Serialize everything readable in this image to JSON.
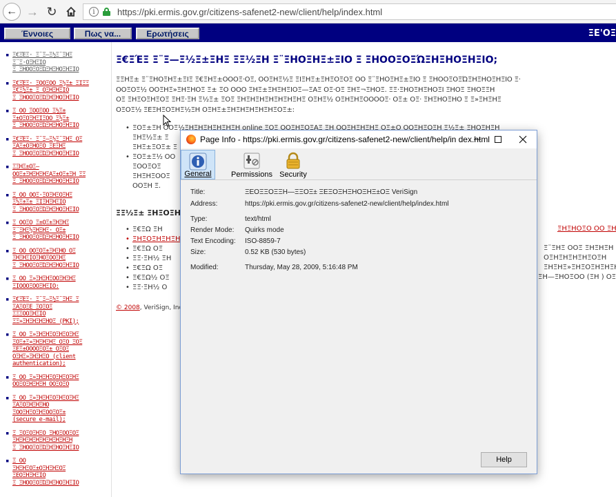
{
  "browser": {
    "url": "https://pki.ermis.gov.gr/citizens-safenet2-new/client/help/index.html"
  },
  "nav": {
    "concepts": "Έννοιες",
    "howto": "Πως να...",
    "questions": "Ερωτήσεις",
    "logo": "ΞΕ'ΟΞ"
  },
  "sidebar": {
    "items": [
      "Ξ€ΞΈΞ· Ξ¨Ξ―Ξ½Ξ΅ΞΗΞ\nΞ¨Ξ·ΟΞΗΞΙΟ\nΞ ΞΗΟΟΞΟΞΏΞΗΞΗΟΞΗΞΙΟ",
      "Ξ€ΞΈΞ· ΞΟΟΞΟΟ Ξ½Ξ± ΞΙΞΞ\nΞ€Ξ½Ξ± Ξ ΟΞΗΞΗΞΙΟ\nΞ ΞΗΟΟΞΟΞΏΞΗΞΗΟΞΗΞΙΟ",
      "Ξ ΟΟ ΞΟΟΞΟΟ Ξ½Ξ±\nΞ±ΟΞΟΞΗΞΙΞΟΟ Ξ½Ξ±\nΞ ΞΗΟΟΞΟΞΏΞΗΞΗΟΞΗΞΙΟ",
      "Ξ€ΞΈΞ· Ξ¨Ξ―Ξ½Ξ΅ΞΗΞ ΟΞ\nΞΑΞ±ΟΞΗΟΞΟ ΞΕΞΗΞ\nΞ ΞΗΟΟΞΟΞΏΞΗΞΗΟΞΗΞΙΟ",
      "ΞΞΗΞ±ΟΞ—\nΟΟΞ±ΞΗΞΗΞΗΞΑΞ±ΟΞ±ΞΗ ΞΞ\nΞ ΞΗΟΟΞΟΞΏΞΗΞΗΟΞΗΞΙΟ",
      "Ξ ΟΟ ΟΟΞ·ΞΟΞΗΞΟΞΗΞ\nΞ½Ξ±Ξ± ΞΙΞΗΞΗΞΙΟ\nΞ ΞΗΟΟΞΟΞΏΞΗΞΗΟΞΗΞΙΟ",
      "Ξ ΟΟΞΟ Ξ±ΟΞ±ΞΗΞΗΞ\nΞ¨ΞΗΞ½ΞΗΞΗΞ· ΟΞ±\nΞ ΞΗΟΟΞΟΞΏΞΗΞΗΟΞΗΞΙΟ",
      "Ξ ΟΟ ΟΟΞΟΞ±ΞΗΞΗΟ ΟΞ\nΞΗΞΗΞΙΟΞΗΟΞΟΟΞΗΞ\nΞ ΞΗΟΟΞΟΞΏΞΗΞΗΟΞΗΞΙΟ",
      "Ξ ΟΟ Ξ»ΞΗΞΗΞΟΟΞΗΞΗΞ\nΞΙΟΟΟΞΟΟΞΗΞΙΟ:",
      "Ξ€ΞΈΞ· Ξ¨Ξ―Ξ½Ξ΅ΞΗΞ Ξ\nΞΑΞΟΞΕ ΞΟΞΟΞ\nΞΞΞΟΟΞΗΞΙΟ\nΞΞ»ΞΗΞΗΞΗΞΗΟΞ (PKI);",
      "Ξ ΟΟ Ξ»ΞΗΞΗΞΟΞΗΞΟΞΗΞ\nΞΟΞ±Ξ»ΞΗΞΗΞΗΞ ΟΞΟ ΞΟΞ\nΞΕΞ±ΟΟΟΟΞΟΞ± ΟΞΟΞ\nΟΞΗΞ»ΞΗΞΗΞΟ (client\nauthentication);",
      "Ξ ΟΟ Ξ»ΞΗΞΗΞΟΞΗΞΟΞΗΞ\nΟΟΞΟΞΗΞΗΞΗ ΟΟΞΟΞΟ",
      "Ξ ΟΟ Ξ»ΞΗΞΗΞΟΞΗΞΟΞΗΞ\nΞΑΞΟΞΗΞΗΞΗΟ\nΞΟΟΞΗΞΟΞΗΞΟΟΞΟΞ±\n(secure e-mail);",
      "Ξ ΞΟΞΟΞΗΞΟ ΞΗΟΞΟΟΞΟΞ\nΞΗΞΗΞΗΞΗΞΗΞΗΞΗΞΗΞΗ\nΞ ΞΗΟΟΞΟΞΏΞΗΞΗΟΞΗΞΙΟ",
      "Ξ ΟΟ\nΞΗΞΗΞΟΞ±ΟΞΗΞΗΞΟΞ\nΞΕΟΞΗΞΗΞΙΟ\nΞ ΞΗΟΟΞΟΞΏΞΗΞΗΟΞΗΞΙΟ"
    ]
  },
  "main": {
    "title": "Ξ€ΞΈΞ Ξ¨Ξ—Ξ½Ξ±ΞΗΞ ΞΞ½ΞΗ Ξ¨ΞΗΟΞΗΞ±ΞΙΟ Ξ ΞΗΟΟΞΟΞΏΞΗΞΗΟΞΗΞΙΟ;",
    "intro": "ΞΞΗΞ± Ξ¨ΞΗΟΞΗΞ±ΞΙΞ Ξ€ΞΗΞ±ΟΟΟΞ·ΟΞ, ΟΟΞΗΞ½Ξ ΞΙΞΗΞ±ΞΗΞΟΞΟΞ ΟΟ Ξ¨ΞΗΟΞΗΞ±ΞΙΟ Ξ ΞΗΟΟΞΟΞΏΞΗΞΗΟΞΗΞΙΟ Ξ·\nΟΟΞΟΞ½ ΟΟΞΗΞ»ΞΗΞΗΟΞ Ξ± ΞΟ ΟΟΟ ΞΗΞ±ΞΗΞΗΞΙΟΞ—ΞΑΞ ΟΞ·ΟΞ ΞΗΞ¬ΞΗΟΞ. ΞΞ·ΞΗΟΞΗΞΗΟΞΙ ΞΗΟΞ ΞΗΟΞΞΗ\nΟΞ ΞΗΞΟΞΗΞΟΞ ΞΗΞ·ΞΗ Ξ½Ξ± ΞΟΞ ΞΗΞΗΞΗΞΗΞΗΞΗΞΗΞ ΟΞΗΞ½ ΟΞΗΞΗΞΟΟΟΟΞ· ΟΞ± ΟΞ· ΞΗΞΗΟΞΗΟ Ξ Ξ»ΞΗΞΗΞ\nΟΞΟΞ½ ΞΕΞΗΞΟΞΗΞ½ΞΗ ΟΞΗΞ±ΞΗΞΗΞΗΞΗΞΗΞΟΞ±:",
    "bullet1": "ΞΟΞ±ΞΗ ΟΟΞ½ΞΗΞΗΞΗΞΗΞΗΞΗ online ΞΟΞ ΟΟΞΗΞΟΞΑΞ ΞΗ ΟΟΞΗΞΗΞΗΞ ΟΞ±Ο ΟΟΞΗΞΟΞΗ Ξ½Ξ± ΞΗΟΞΗΞΗ\nΞΗΞ½Ξ± Ξ\nΞΗΞ±ΞΟΞ± Ξ",
    "bullet2": "ΞΟΞ±Ξ½ ΟΟ\nΞΟΟΞΟΞ\nΞΗΞΗΞΟΟΞ\nΟΟΞΗ Ξ.",
    "section2": "ΞΞ½Ξ± ΞΗΞΟΞΗΞ±ΞΙΞ ΞΗΞΗΞΗΞΗΞΗΞΗΞΗΞΗΞΗ",
    "s2_items": [
      "Ξ€ΞΩ ΞΗ",
      "ΞΗΞΟΞΗΞΗΞΗΞ",
      "Ξ€ΞΩ ΟΞ",
      "ΞΞ·ΞΗ½ ΞΗ",
      "Ξ€ΞΩ ΟΞ",
      "Ξ€ΞΩ½ ΟΞ",
      "ΞΞ·ΞΗ½ Ο"
    ],
    "right_fragments": [
      "ΞΗΞΗΟΞΟ ΟΟ ΞΗ»Ξ·Ο",
      "Ξ¨ΞΗΞ ΟΟΞ ΞΗΞΗΞΗ ΞΗ",
      "ΟΞΗΞΗΞΗΞΗΞΟΞΗ",
      "ΞΗΞΗΞ»ΞΗΞΟΞΗΞΗΞΗΟ",
      "ΞΗ—ΞΗΟΞΟΟ (ΞΗ ) ΟΞ"
    ],
    "copyright_year": "© 2008",
    "copyright_rest": ", VeriSign, Inc. A"
  },
  "dialog": {
    "title": "Page Info - https://pki.ermis.gov.gr/citizens-safenet2-new/client/help/in dex.html",
    "tabs": {
      "general": "General",
      "permissions": "Permissions",
      "security": "Security"
    },
    "fields": {
      "title_label": "Title:",
      "title_value": "ΞΕΟΞΞΟΞΞΗ—ΞΞΟΞ± ΞΕΞΟΞΗΞΗΟΞΗΞ±ΟΞ VeriSign",
      "address_label": "Address:",
      "address_value": "https://pki.ermis.gov.gr/citizens-safenet2-new/client/help/index.html",
      "type_label": "Type:",
      "type_value": "text/html",
      "render_label": "Render Mode:",
      "render_value": "Quirks mode",
      "encoding_label": "Text Encoding:",
      "encoding_value": "ISO-8859-7",
      "size_label": "Size:",
      "size_value": "0.52 KB (530 bytes)",
      "modified_label": "Modified:",
      "modified_value": "Thursday, May 28, 2009, 5:16:48 PM"
    },
    "help": "Help"
  }
}
